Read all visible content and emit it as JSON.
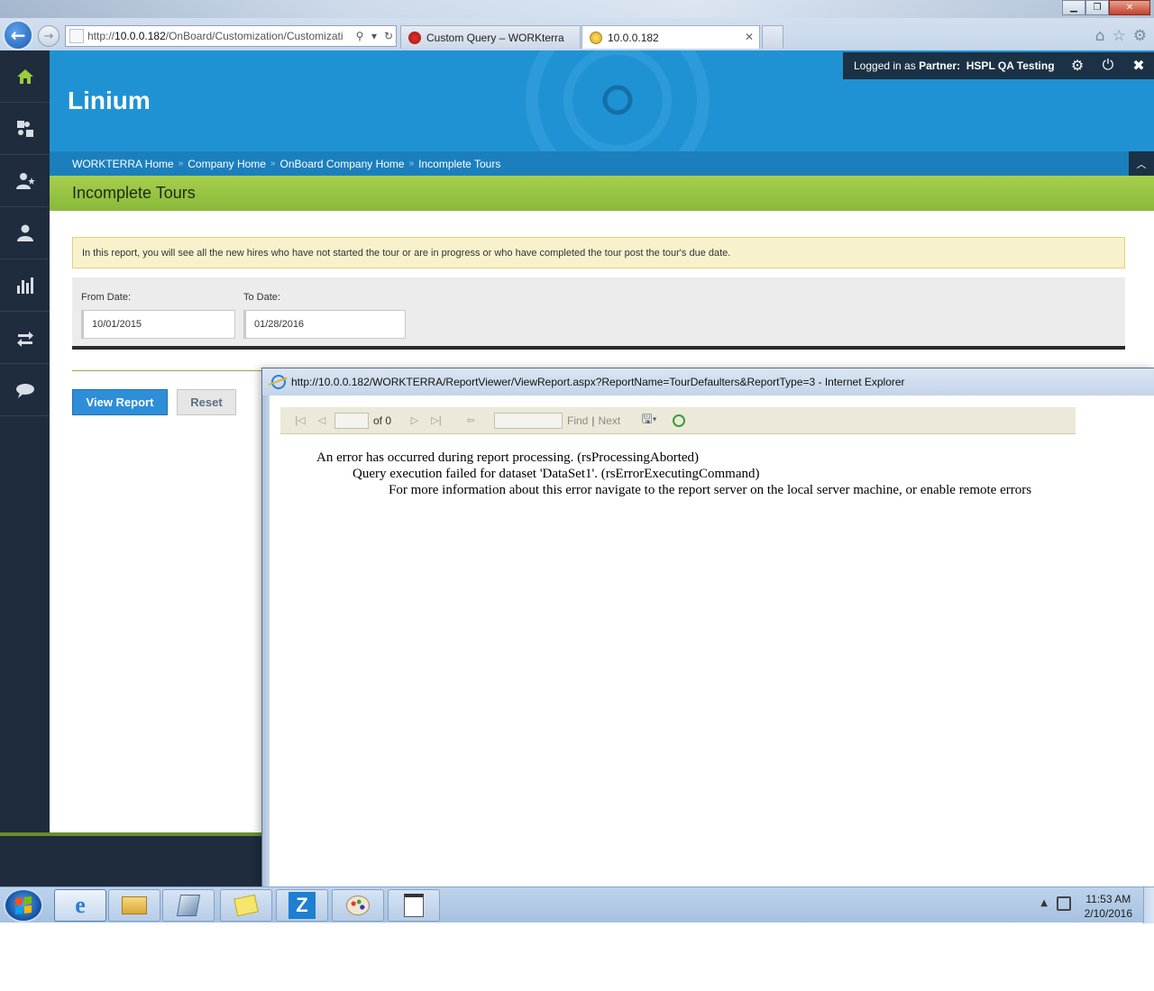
{
  "browser": {
    "address_prefix": "http://",
    "address_host": "10.0.0.182",
    "address_path": "/OnBoard/Customization/Customizati",
    "tabs": [
      {
        "title": "Custom Query – WORKterra"
      },
      {
        "title": "10.0.0.182"
      }
    ]
  },
  "app": {
    "brand": "Linium",
    "user_prefix": "Logged in as",
    "user_role": "Partner:",
    "user_name": "HSPL QA Testing",
    "breadcrumbs": [
      "WORKTERRA Home",
      "Company Home",
      "OnBoard Company Home",
      "Incomplete Tours"
    ],
    "breadcrumb_sep": "»",
    "page_title": "Incomplete Tours",
    "info_text": "In this report, you will see all the new hires who have not started the tour or are in progress or who have completed the tour post the tour's due date.",
    "from_label": "From Date:",
    "from_value": "10/01/2015",
    "to_label": "To Date:",
    "to_value": "01/28/2016",
    "view_button": "View Report",
    "reset_button": "Reset"
  },
  "popup": {
    "title": "http://10.0.0.182/WORKTERRA/ReportViewer/ViewReport.aspx?ReportName=TourDefaulters&ReportType=3 - Internet Explorer",
    "of_label": "of 0",
    "find_label": "Find",
    "next_label": "Next",
    "errors": [
      "An error has occurred during report processing. (rsProcessingAborted)",
      "Query execution failed for dataset 'DataSet1'. (rsErrorExecutingCommand)",
      "For more information about this error navigate to the report server on the local server machine, or enable remote errors"
    ]
  },
  "taskbar": {
    "time": "11:53 AM",
    "date": "2/10/2016",
    "z_app_label": "Z"
  },
  "colors": {
    "header_blue": "#1f92d4",
    "title_green": "#8ab93b",
    "sidebar_dark": "#1e2c3e",
    "view_button_blue": "#2e8ed8"
  }
}
